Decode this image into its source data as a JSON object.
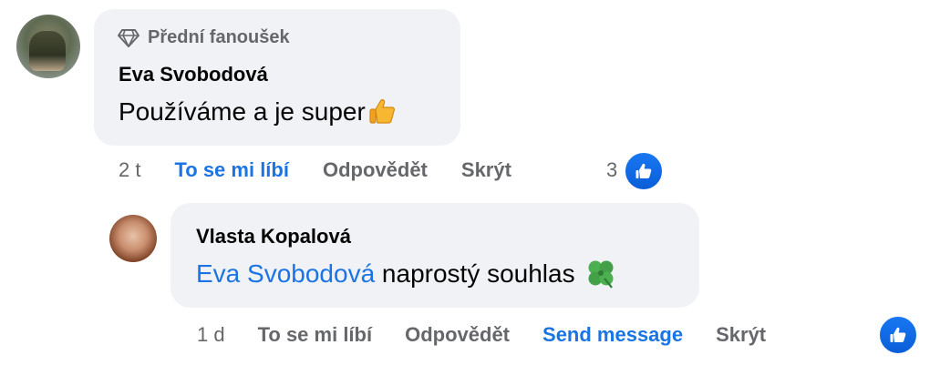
{
  "comment": {
    "badge_label": "Přední fanoušek",
    "author": "Eva Svobodová",
    "text": "Používáme a je super",
    "emoji": "thumbs-up-emoji",
    "time": "2 t",
    "like_label": "To se mi líbí",
    "reply_label": "Odpovědět",
    "hide_label": "Skrýt",
    "reaction_count": "3",
    "reaction_icon": "like-icon"
  },
  "reply": {
    "author": "Vlasta Kopalová",
    "mention": "Eva Svobodová",
    "text": "naprostý souhlas",
    "emoji": "four-leaf-clover-emoji",
    "time": "1 d",
    "like_label": "To se mi líbí",
    "reply_label": "Odpovědět",
    "send_message_label": "Send message",
    "hide_label": "Skrýt",
    "reaction_icon": "like-icon"
  },
  "colors": {
    "accent": "#1b74e4",
    "bubble": "#f0f2f5",
    "secondary_text": "#65676b",
    "primary_text": "#050505"
  }
}
